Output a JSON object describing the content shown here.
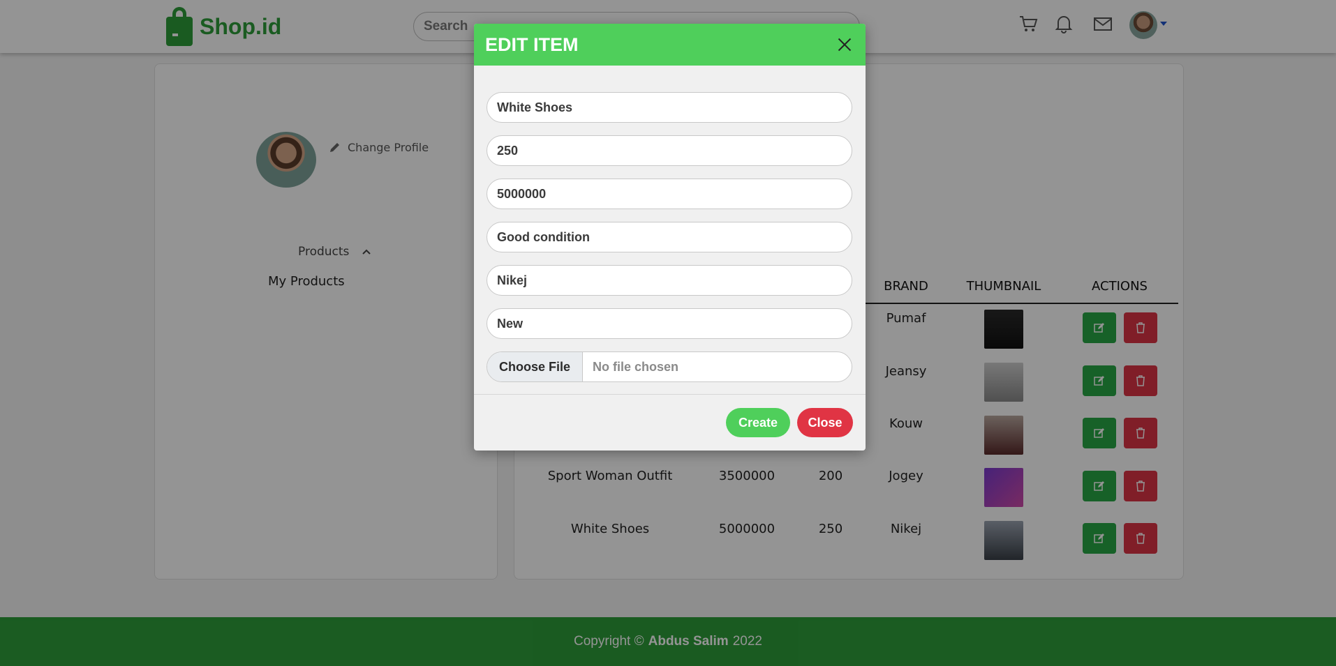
{
  "colors": {
    "brand_green": "#2e9e3a",
    "modal_green": "#4fcf5b",
    "danger_red": "#dc3545",
    "edit_green": "#28a745"
  },
  "navbar": {
    "brand": "Shop.id",
    "search_placeholder": "Search",
    "icons": [
      "cart-icon",
      "bell-icon",
      "mail-icon",
      "avatar"
    ]
  },
  "sidebar": {
    "change_profile": "Change Profile",
    "section": "Products",
    "item": "My Products"
  },
  "table": {
    "headers": [
      "BRAND",
      "THUMBNAIL",
      "ACTIONS"
    ],
    "rows": [
      {
        "name": "",
        "price": "",
        "stock": "",
        "brand": "Pumaf"
      },
      {
        "name": "",
        "price": "",
        "stock": "",
        "brand": "Jeansy"
      },
      {
        "name": "",
        "price": "",
        "stock": "",
        "brand": "Kouw"
      },
      {
        "name": "Sport Woman Outfit",
        "price": "3500000",
        "stock": "200",
        "brand": "Jogey"
      },
      {
        "name": "White Shoes",
        "price": "5000000",
        "stock": "250",
        "brand": "Nikej"
      }
    ]
  },
  "modal": {
    "title": "EDIT ITEM",
    "fields": {
      "name": "White Shoes",
      "stock": "250",
      "price": "5000000",
      "description": "Good condition",
      "brand": "Nikej",
      "condition": "New"
    },
    "file_button": "Choose File",
    "file_status": "No file chosen",
    "create_label": "Create",
    "close_label": "Close"
  },
  "footer": {
    "prefix": "Copyright ©",
    "author": "Abdus Salim",
    "year": "2022"
  }
}
